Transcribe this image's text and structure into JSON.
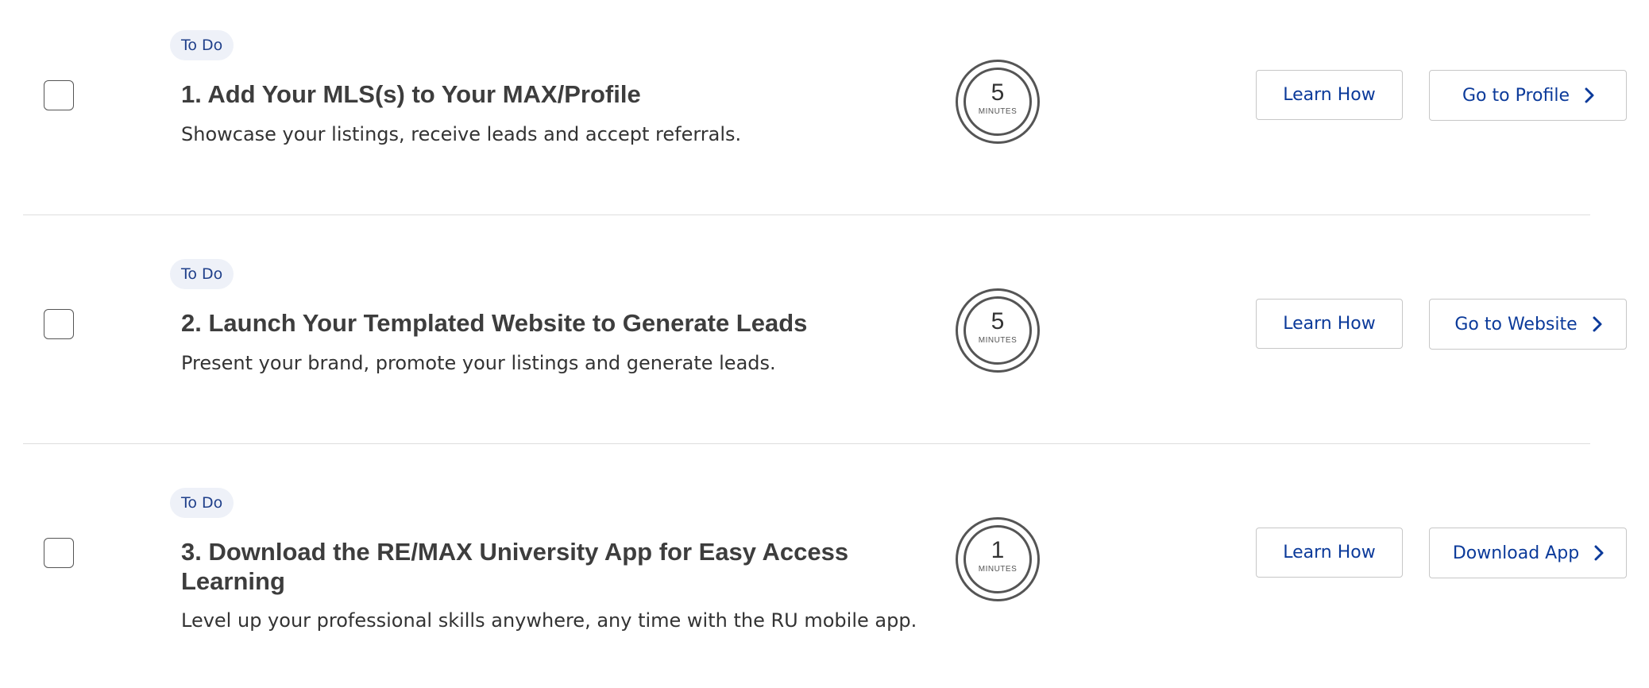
{
  "tasks": [
    {
      "status": "To Do",
      "title": "1. Add Your MLS(s) to Your MAX/Profile",
      "description": "Showcase your listings, receive leads and accept referrals.",
      "minutes": "5",
      "minutes_label": "MINUTES",
      "learn_label": "Learn How",
      "action_label": "Go to Profile"
    },
    {
      "status": "To Do",
      "title": "2. Launch Your Templated Website to Generate Leads",
      "description": "Present your brand, promote your listings and generate leads.",
      "minutes": "5",
      "minutes_label": "MINUTES",
      "learn_label": "Learn How",
      "action_label": "Go to Website"
    },
    {
      "status": "To Do",
      "title": "3. Download the RE/MAX University App for Easy Access Learning",
      "description": "Level up your professional skills anywhere, any time with the RU mobile app.",
      "minutes": "1",
      "minutes_label": "MINUTES",
      "learn_label": "Learn How",
      "action_label": "Download App"
    }
  ],
  "colors": {
    "link_blue": "#0b3a9a",
    "badge_bg": "#eef1f8",
    "badge_text": "#1f3f8a",
    "title_text": "#3d3d3d",
    "divider": "#dedede"
  },
  "icons": {
    "checkbox": "checkbox-icon",
    "timer": "stopwatch-ring-icon",
    "chevron": "chevron-right-icon"
  }
}
